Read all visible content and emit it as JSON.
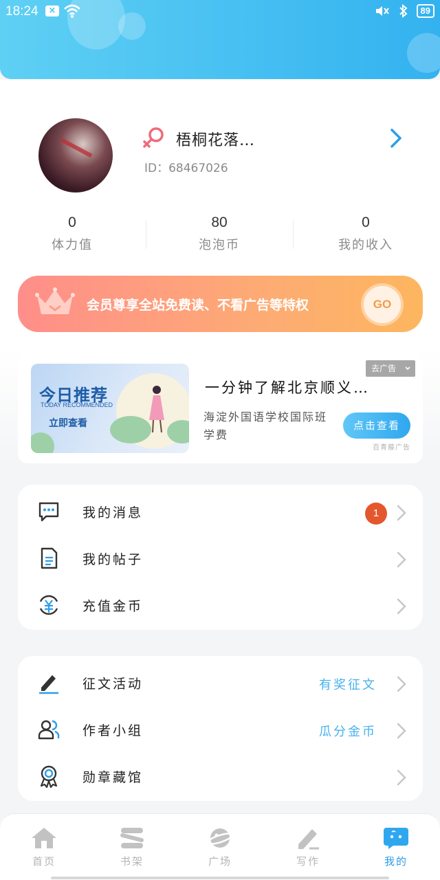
{
  "status_bar": {
    "time": "18:24",
    "notification_icon": "x-box-icon",
    "battery": "89"
  },
  "profile": {
    "username": "梧桐花落…",
    "user_id": "ID：68467026",
    "gender": "female"
  },
  "stats": [
    {
      "value": "0",
      "label": "体力值"
    },
    {
      "value": "80",
      "label": "泡泡币"
    },
    {
      "value": "0",
      "label": "我的收入"
    }
  ],
  "vip": {
    "text": "会员尊享全站免费读、不看广告等特权",
    "go_label": "GO"
  },
  "ad": {
    "image_title": "今日推荐",
    "image_subtitle": "TODAY RECOMMENDED",
    "image_button": "立即查看",
    "title": "一分钟了解北京顺义…",
    "description": "海淀外国语学校国际班学费",
    "close_label": "去广告",
    "action_label": "点击查看",
    "source": "百青藤广告"
  },
  "menu_group_1": [
    {
      "label": "我的消息",
      "badge": "1",
      "icon": "message-icon"
    },
    {
      "label": "我的帖子",
      "icon": "document-icon"
    },
    {
      "label": "充值金币",
      "icon": "yuan-coin-icon"
    }
  ],
  "menu_group_2": [
    {
      "label": "征文活动",
      "extra": "有奖征文",
      "icon": "pen-icon"
    },
    {
      "label": "作者小组",
      "extra": "瓜分金币",
      "icon": "group-icon"
    },
    {
      "label": "勋章藏馆",
      "icon": "medal-icon"
    }
  ],
  "bottom_nav": [
    {
      "label": "首页",
      "icon": "home-icon"
    },
    {
      "label": "书架",
      "icon": "bookshelf-icon"
    },
    {
      "label": "广场",
      "icon": "planet-icon"
    },
    {
      "label": "写作",
      "icon": "write-icon"
    },
    {
      "label": "我的",
      "icon": "profile-chat-icon",
      "active": true
    }
  ],
  "colors": {
    "accent": "#2d9de6",
    "header": "#33b2f0",
    "badge": "#e4572e",
    "vip_start": "#ff8e8a",
    "vip_end": "#fdb65f"
  }
}
